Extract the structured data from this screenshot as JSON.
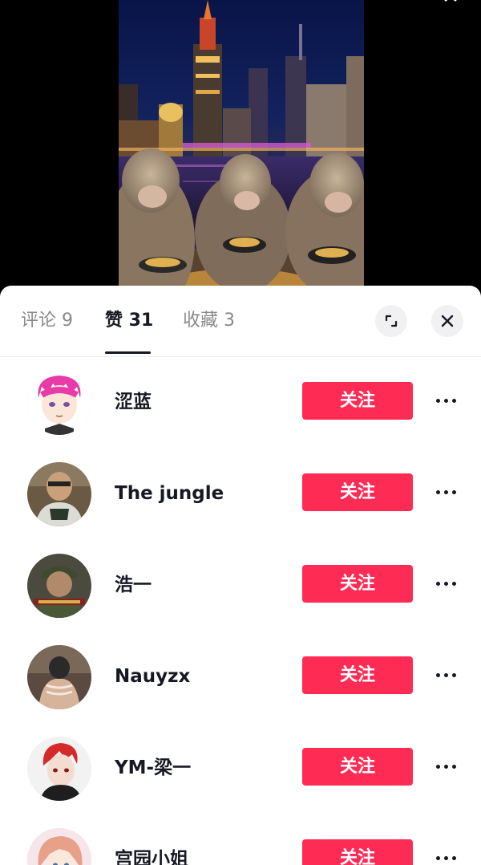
{
  "tabs": [
    {
      "label": "评论 9"
    },
    {
      "label": "赞 31"
    },
    {
      "label": "收藏 3"
    }
  ],
  "active_tab": "赞 31",
  "icons": {
    "expand": "expand-icon",
    "close": "close-icon",
    "more": "more-dots-icon"
  },
  "colors": {
    "accent": "#fe2c55",
    "text_primary": "#161823",
    "text_secondary": "#8a8a8a"
  },
  "users": [
    {
      "name": "涩蓝",
      "follow_label": "关注"
    },
    {
      "name": "The jungle",
      "follow_label": "关注"
    },
    {
      "name": "浩一",
      "follow_label": "关注"
    },
    {
      "name": "Nauyzx",
      "follow_label": "关注"
    },
    {
      "name": "YM-梁一",
      "follow_label": "关注"
    },
    {
      "name": "宫园小姐",
      "follow_label": "关注"
    }
  ]
}
